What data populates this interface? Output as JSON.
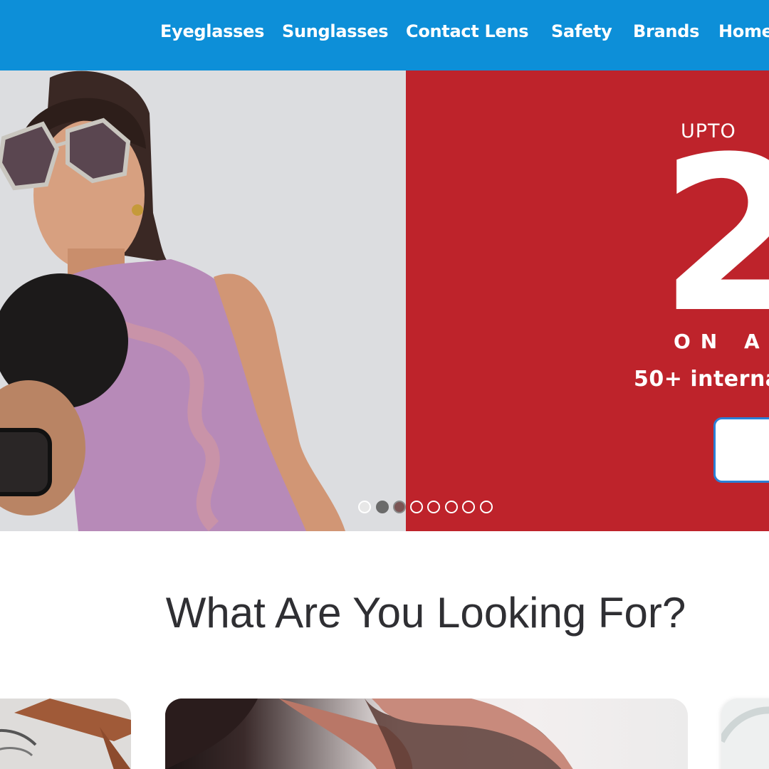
{
  "nav": {
    "items": [
      {
        "label": "Eyeglasses"
      },
      {
        "label": "Sunglasses"
      },
      {
        "label": "Contact Lens"
      },
      {
        "label": "Safety"
      },
      {
        "label": "Brands"
      },
      {
        "label": "Home"
      }
    ]
  },
  "colors": {
    "nav_bg": "#0d8fd8",
    "hero_red": "#be232b",
    "hero_grey": "#dcdde0",
    "text_dark": "#2f2f33"
  },
  "hero": {
    "upto": "UPTO",
    "big_number": "2",
    "on_all": "ON A",
    "international": "50+ interna",
    "carousel": {
      "total_slides": 8,
      "active_index": 0
    }
  },
  "section": {
    "title": "What Are You Looking For?"
  }
}
